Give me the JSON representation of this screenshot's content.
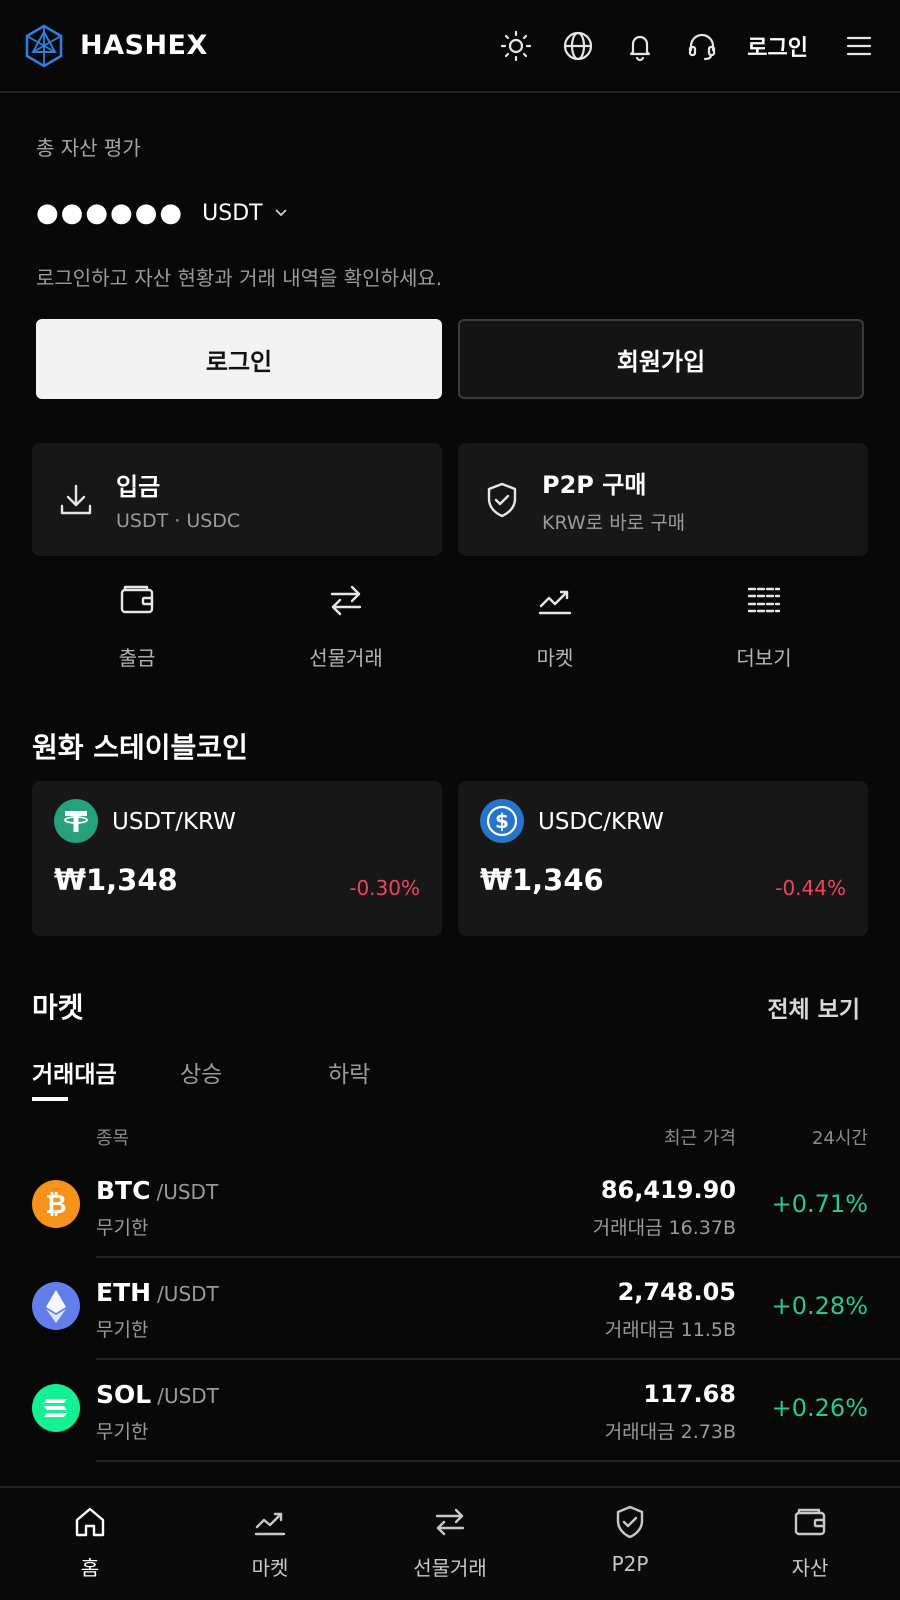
{
  "header": {
    "brand": "HASHEX",
    "login_label": "로그인",
    "icons": [
      "sun-icon",
      "globe-icon",
      "bell-icon",
      "headset-icon",
      "menu-icon"
    ]
  },
  "summary": {
    "label": "총 자산 평가",
    "masked_balance": "●●●●●●",
    "currency": "USDT",
    "hint": "로그인하고 자산 현황과 거래 내역을 확인하세요."
  },
  "buttons": {
    "login": "로그인",
    "signup": "회원가입"
  },
  "quick_cards": [
    {
      "title": "입금",
      "subtitle": "USDT · USDC",
      "icon": "download-icon"
    },
    {
      "title": "P2P 구매",
      "subtitle": "KRW로 바로 구매",
      "icon": "shield-check-icon"
    }
  ],
  "shortcuts": [
    {
      "label": "출금",
      "icon": "wallet-icon"
    },
    {
      "label": "선물거래",
      "icon": "swap-arrows-icon"
    },
    {
      "label": "마켓",
      "icon": "chart-line-icon"
    },
    {
      "label": "더보기",
      "icon": "grid-more-icon"
    }
  ],
  "stablecoins": {
    "title": "원화 스테이블코인",
    "items": [
      {
        "pair": "USDT/KRW",
        "price": "₩1,348",
        "change": "-0.30%",
        "icon": "tether-icon",
        "color": "#26a17b"
      },
      {
        "pair": "USDC/KRW",
        "price": "₩1,346",
        "change": "-0.44%",
        "icon": "usdc-icon",
        "color": "#2775ca"
      }
    ]
  },
  "market": {
    "title": "마켓",
    "view_all": "전체 보기",
    "tabs": [
      {
        "label": "거래대금",
        "active": true
      },
      {
        "label": "상승",
        "active": false
      },
      {
        "label": "하락",
        "active": false
      }
    ],
    "columns": {
      "symbol": "종목",
      "price": "최근 가격",
      "change": "24시간"
    },
    "rows": [
      {
        "symbol": "BTC",
        "quote": "/USDT",
        "type": "무기한",
        "price": "86,419.90",
        "volume": "거래대금 16.37B",
        "change": "+0.71%",
        "icon": "bitcoin-icon",
        "color": "#f7931a"
      },
      {
        "symbol": "ETH",
        "quote": "/USDT",
        "type": "무기한",
        "price": "2,748.05",
        "volume": "거래대금 11.5B",
        "change": "+0.28%",
        "icon": "ethereum-icon",
        "color": "#627eea"
      },
      {
        "symbol": "SOL",
        "quote": "/USDT",
        "type": "무기한",
        "price": "117.68",
        "volume": "거래대금 2.73B",
        "change": "+0.26%",
        "icon": "solana-icon",
        "color": "#14f195"
      }
    ]
  },
  "bottom_nav": [
    {
      "label": "홈",
      "icon": "home-icon",
      "active": true
    },
    {
      "label": "마켓",
      "icon": "chart-line-icon",
      "active": false
    },
    {
      "label": "선물거래",
      "icon": "swap-arrows-icon",
      "active": false
    },
    {
      "label": "P2P",
      "icon": "shield-check-icon",
      "active": false
    },
    {
      "label": "자산",
      "icon": "wallet-icon",
      "active": false
    }
  ],
  "colors": {
    "background": "#080808",
    "card": "#171717",
    "positive": "#28c98e",
    "negative": "#f0445d",
    "logo": "#2f7fe0"
  }
}
